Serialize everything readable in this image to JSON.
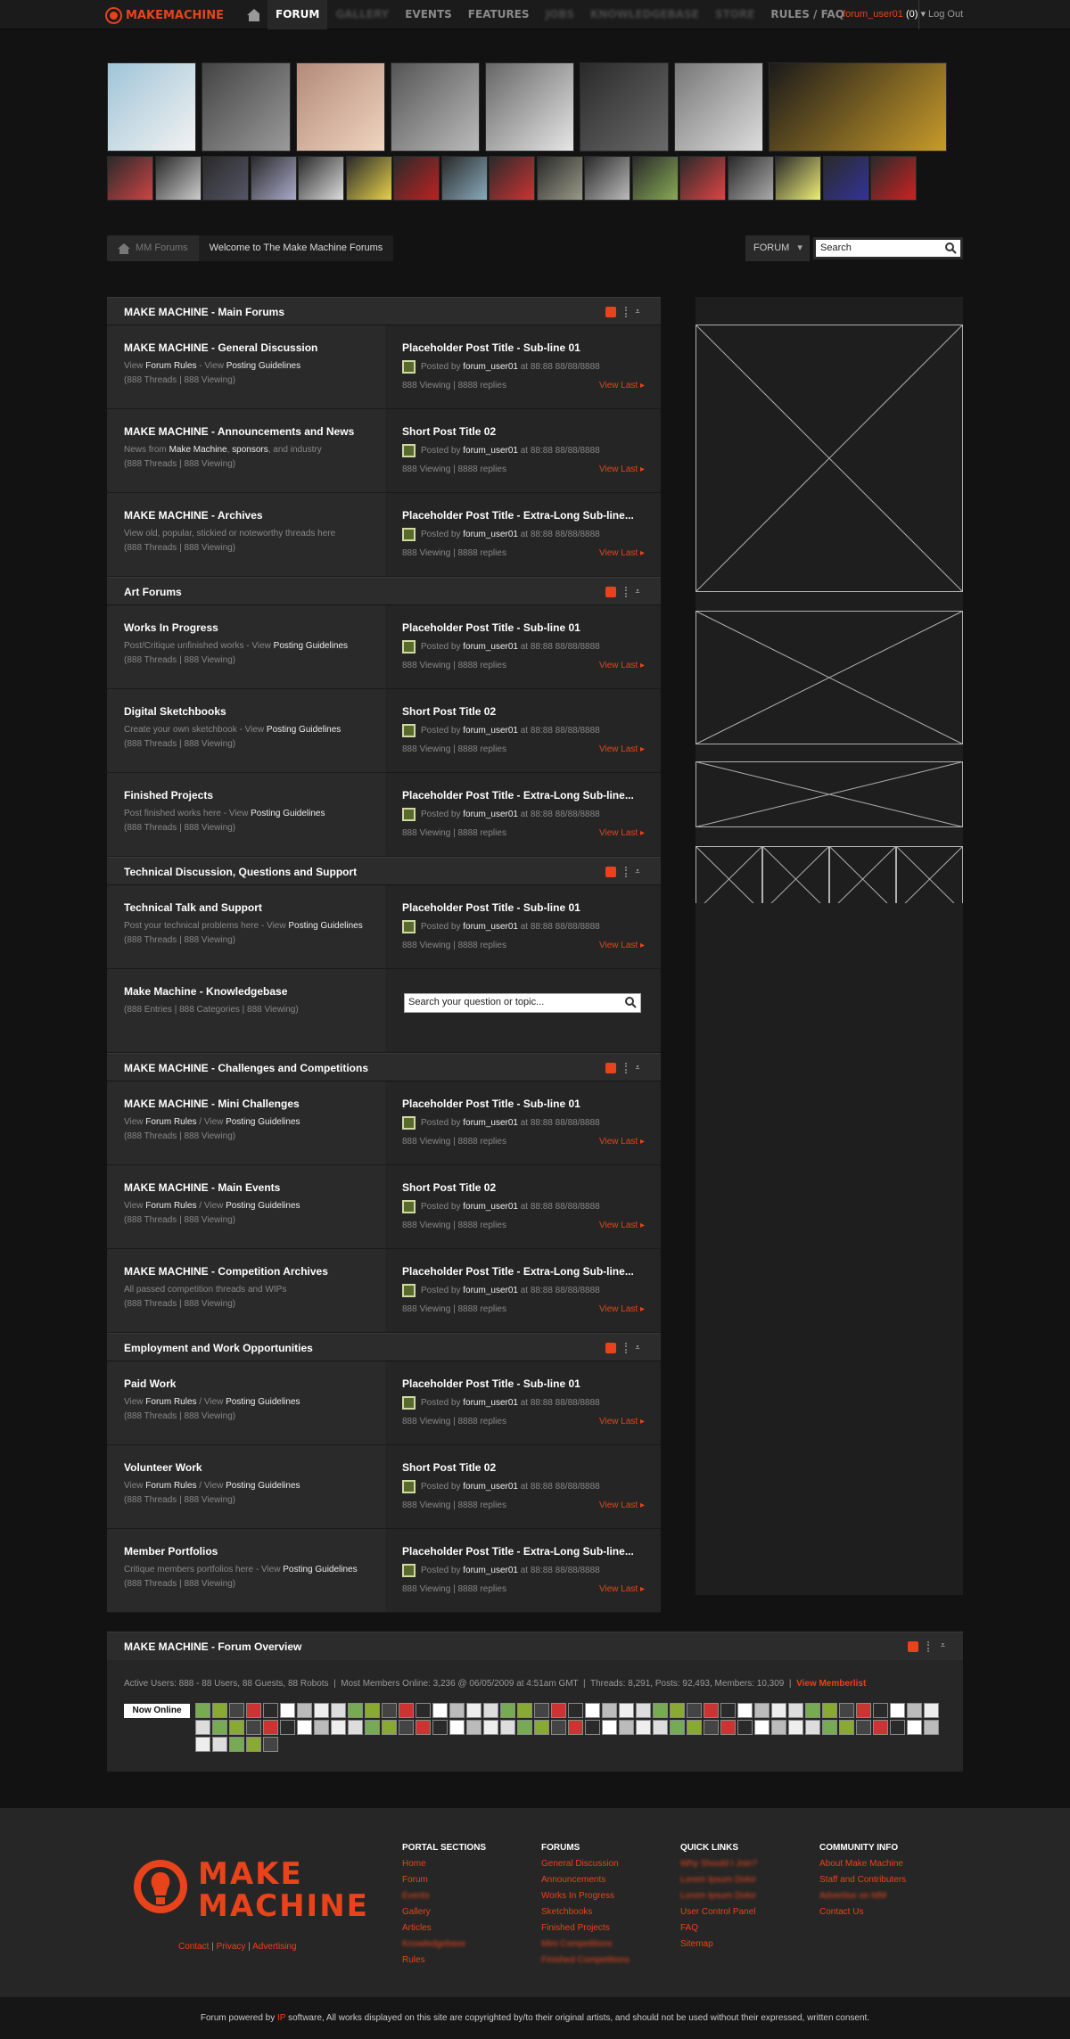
{
  "header": {
    "logo": "MAKEMACHINE",
    "nav": [
      {
        "label": "FORUM",
        "active": true,
        "blur": false
      },
      {
        "label": "GALLERY",
        "active": false,
        "blur": true
      },
      {
        "label": "EVENTS",
        "active": false,
        "blur": false
      },
      {
        "label": "FEATURES",
        "active": false,
        "blur": false
      },
      {
        "label": "JOBS",
        "active": false,
        "blur": true
      },
      {
        "label": "KNOWLEDGEBASE",
        "active": false,
        "blur": true
      },
      {
        "label": "STORE",
        "active": false,
        "blur": true
      },
      {
        "label": "RULES / FAQ",
        "active": false,
        "blur": false
      }
    ],
    "username": "forum_user01",
    "count": "(0)",
    "logout": "Log Out"
  },
  "breadcrumb": {
    "home": "MM Forums",
    "current": "Welcome to The Make Machine Forums"
  },
  "forum_select": "FORUM",
  "search_placeholder": "Search",
  "categories": [
    {
      "title": "MAKE MACHINE - Main Forums",
      "forums": [
        {
          "name": "MAKE MACHINE - General Discussion",
          "desc": [
            [
              "View ",
              0
            ],
            [
              "Forum Rules",
              1
            ],
            [
              " - View ",
              0
            ],
            [
              "Posting Guidelines",
              1
            ]
          ],
          "stats": "(888 Threads | 888 Viewing)",
          "post": "Placeholder Post Title - Sub-line 01"
        },
        {
          "name": "MAKE MACHINE - Announcements and News",
          "desc": [
            [
              "News from ",
              0
            ],
            [
              "Make Machine",
              1
            ],
            [
              ", ",
              0
            ],
            [
              "sponsors",
              1
            ],
            [
              ", and industry",
              0
            ]
          ],
          "stats": "(888 Threads | 888 Viewing)",
          "post": "Short Post Title 02"
        },
        {
          "name": "MAKE MACHINE - Archives",
          "desc": [
            [
              "View old, popular, stickied or noteworthy threads here",
              0
            ]
          ],
          "stats": "(888 Threads | 888 Viewing)",
          "post": "Placeholder Post Title - Extra-Long Sub-line..."
        }
      ]
    },
    {
      "title": "Art Forums",
      "forums": [
        {
          "name": "Works In Progress",
          "desc": [
            [
              "Post/Critique unfinished works - View ",
              0
            ],
            [
              "Posting Guidelines",
              1
            ]
          ],
          "stats": "(888 Threads | 888 Viewing)",
          "post": "Placeholder Post Title - Sub-line 01"
        },
        {
          "name": "Digital Sketchbooks",
          "desc": [
            [
              "Create your own sketchbook - View ",
              0
            ],
            [
              "Posting Guidelines",
              1
            ]
          ],
          "stats": "(888 Threads | 888 Viewing)",
          "post": "Short Post Title 02"
        },
        {
          "name": "Finished Projects",
          "desc": [
            [
              "Post finished works here - View ",
              0
            ],
            [
              "Posting Guidelines",
              1
            ]
          ],
          "stats": "(888 Threads | 888 Viewing)",
          "post": "Placeholder Post Title - Extra-Long Sub-line..."
        }
      ]
    },
    {
      "title": "Technical Discussion, Questions and Support",
      "forums": [
        {
          "name": "Technical Talk and Support",
          "desc": [
            [
              "Post your technical problems here - View ",
              0
            ],
            [
              "Posting Guidelines",
              1
            ]
          ],
          "stats": "(888 Threads | 888 Viewing)",
          "post": "Placeholder Post Title - Sub-line 01"
        },
        {
          "name": "Make Machine - Knowledgebase",
          "kb": true,
          "stats": "(888 Entries | 888 Categories | 888 Viewing)",
          "kb_placeholder": "Search your question or topic..."
        }
      ]
    },
    {
      "title": "MAKE MACHINE - Challenges and Competitions",
      "forums": [
        {
          "name": "MAKE MACHINE - Mini Challenges",
          "desc": [
            [
              "View ",
              0
            ],
            [
              "Forum Rules",
              1
            ],
            [
              " / View ",
              0
            ],
            [
              "Posting Guidelines",
              1
            ]
          ],
          "stats": "(888 Threads | 888 Viewing)",
          "post": "Placeholder Post Title - Sub-line 01"
        },
        {
          "name": "MAKE MACHINE - Main Events",
          "desc": [
            [
              "View ",
              0
            ],
            [
              "Forum Rules",
              1
            ],
            [
              " / View ",
              0
            ],
            [
              "Posting Guidelines",
              1
            ]
          ],
          "stats": "(888 Threads | 888 Viewing)",
          "post": "Short Post Title 02"
        },
        {
          "name": "MAKE MACHINE - Competition Archives",
          "desc": [
            [
              "All passed competition threads and WIPs",
              0
            ]
          ],
          "stats": "(888 Threads | 888 Viewing)",
          "post": "Placeholder Post Title - Extra-Long Sub-line..."
        }
      ]
    },
    {
      "title": "Employment and Work Opportunities",
      "forums": [
        {
          "name": "Paid Work",
          "desc": [
            [
              "View ",
              0
            ],
            [
              "Forum Rules",
              1
            ],
            [
              " / View ",
              0
            ],
            [
              "Posting Guidelines",
              1
            ]
          ],
          "stats": "(888 Threads | 888 Viewing)",
          "post": "Placeholder Post Title - Sub-line 01"
        },
        {
          "name": "Volunteer Work",
          "desc": [
            [
              "View ",
              0
            ],
            [
              "Forum Rules",
              1
            ],
            [
              " / View ",
              0
            ],
            [
              "Posting Guidelines",
              1
            ]
          ],
          "stats": "(888 Threads | 888 Viewing)",
          "post": "Short Post Title 02"
        },
        {
          "name": "Member Portfolios",
          "desc": [
            [
              "Critique members portfolios here - View ",
              0
            ],
            [
              "Posting Guidelines",
              1
            ]
          ],
          "stats": "(888 Threads | 888 Viewing)",
          "post": "Placeholder Post Title - Extra-Long Sub-line..."
        }
      ]
    }
  ],
  "lastpost": {
    "posted_by": "Posted by ",
    "user": "forum_user01",
    "at": " at 88:88 88/88/8888",
    "views": "888 Viewing | 8888 replies",
    "view_last": "View Last  ▸"
  },
  "overview": {
    "title": "MAKE MACHINE - Forum Overview",
    "active": "Active Users: 888 - 88 Users, 88 Guests, 88 Robots",
    "most": "Most Members Online: 3,236 @ 06/05/2009 at 4:51am GMT",
    "totals": "Threads: 8,291, Posts: 92,493, Members: 10,309",
    "memberlist": "View Memberlist",
    "now_online": "Now Online"
  },
  "footer": {
    "cols": [
      {
        "h": "PORTAL SECTIONS",
        "items": [
          [
            "Home",
            0
          ],
          [
            "Forum",
            0
          ],
          [
            "Events",
            1
          ],
          [
            "Gallery",
            0
          ],
          [
            "Articles",
            0
          ],
          [
            "Knowledgebase",
            1
          ],
          [
            "Rules",
            0
          ]
        ]
      },
      {
        "h": "FORUMS",
        "items": [
          [
            "General Discussion",
            0
          ],
          [
            "Announcements",
            0
          ],
          [
            "Works In Progress",
            0
          ],
          [
            "Sketchbooks",
            0
          ],
          [
            "Finished Projects",
            0
          ],
          [
            "Mini Competitions",
            1
          ],
          [
            "Finished Competitions",
            1
          ]
        ]
      },
      {
        "h": "QUICK LINKS",
        "items": [
          [
            "Why Should I Join?",
            1
          ],
          [
            "Lorem Ipsum Dolor",
            1
          ],
          [
            "Lorem Ipsum Dolor",
            1
          ],
          [
            "User Control Panel",
            0
          ],
          [
            "FAQ",
            0
          ],
          [
            "Sitemap",
            0
          ]
        ]
      },
      {
        "h": "COMMUNITY INFO",
        "items": [
          [
            "About Make Machine",
            0
          ],
          [
            "Staff and Contributers",
            0
          ],
          [
            "Advertise on MM",
            1
          ],
          [
            "Contact Us",
            0
          ]
        ]
      }
    ],
    "logo1": "MAKE",
    "logo2": "MACHINE",
    "links": [
      "Contact",
      "Privacy",
      "Advertising"
    ],
    "copyright": [
      "Forum powered by ",
      "IP",
      " software, All works displayed on this site are copyrighted by/to their original artists, and should not be used without their expressed, written consent."
    ]
  },
  "colors": {
    "accent": "#e8431a"
  }
}
